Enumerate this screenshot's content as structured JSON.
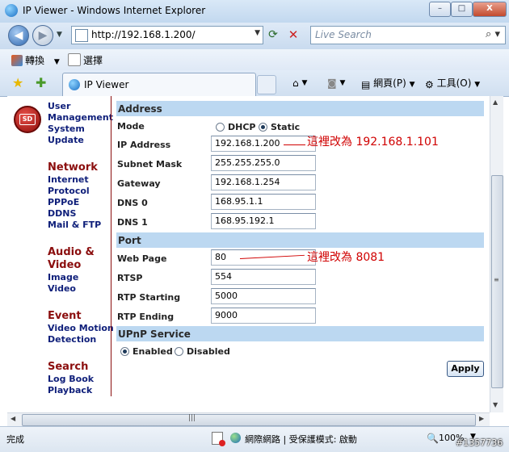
{
  "window": {
    "title": "IP Viewer - Windows Internet Explorer",
    "minimize": "–",
    "maximize": "□",
    "close": "X"
  },
  "address_bar": {
    "url": "http://192.168.1.200/",
    "search_placeholder": "Live Search"
  },
  "links_bar": {
    "convert": "轉換",
    "select": "選擇"
  },
  "tab": {
    "label": "IP Viewer"
  },
  "command_bar": {
    "page": "網頁(P)",
    "tools": "工具(O)"
  },
  "nav": {
    "user_items": [
      "User",
      "Management",
      "System",
      "Update"
    ],
    "network_head": "Network",
    "network_items": [
      "Internet",
      "Protocol",
      "PPPoE",
      "DDNS",
      "Mail & FTP"
    ],
    "av_head": [
      "Audio &",
      "Video"
    ],
    "av_items": [
      "Image",
      "Video"
    ],
    "event_head": "Event",
    "event_items": [
      "Video Motion",
      "Detection"
    ],
    "search_head": "Search",
    "search_items": [
      "Log Book",
      "Playback"
    ]
  },
  "form": {
    "address_section": "Address",
    "mode_label": "Mode",
    "dhcp_label": "DHCP",
    "static_label": "Static",
    "mode_selected": "Static",
    "ip_label": "IP Address",
    "ip_value": "192.168.1.200",
    "mask_label": "Subnet Mask",
    "mask_value": "255.255.255.0",
    "gateway_label": "Gateway",
    "gateway_value": "192.168.1.254",
    "dns0_label": "DNS 0",
    "dns0_value": "168.95.1.1",
    "dns1_label": "DNS 1",
    "dns1_value": "168.95.192.1",
    "port_section": "Port",
    "web_label": "Web Page",
    "web_value": "80",
    "rtsp_label": "RTSP",
    "rtsp_value": "554",
    "rtp_start_label": "RTP Starting",
    "rtp_start_value": "5000",
    "rtp_end_label": "RTP Ending",
    "rtp_end_value": "9000",
    "upnp_section": "UPnP Service",
    "enabled_label": "Enabled",
    "disabled_label": "Disabled",
    "upnp_selected": "Enabled",
    "apply": "Apply"
  },
  "annotations": {
    "ip_note": "這裡改為 192.168.1.101",
    "port_note": "這裡改為 8081",
    "color": "#d00000"
  },
  "status_bar": {
    "done": "完成",
    "zone": "網際網路 | 受保護模式: 啟動",
    "zoom": "100%"
  },
  "watermark": "#1357736"
}
